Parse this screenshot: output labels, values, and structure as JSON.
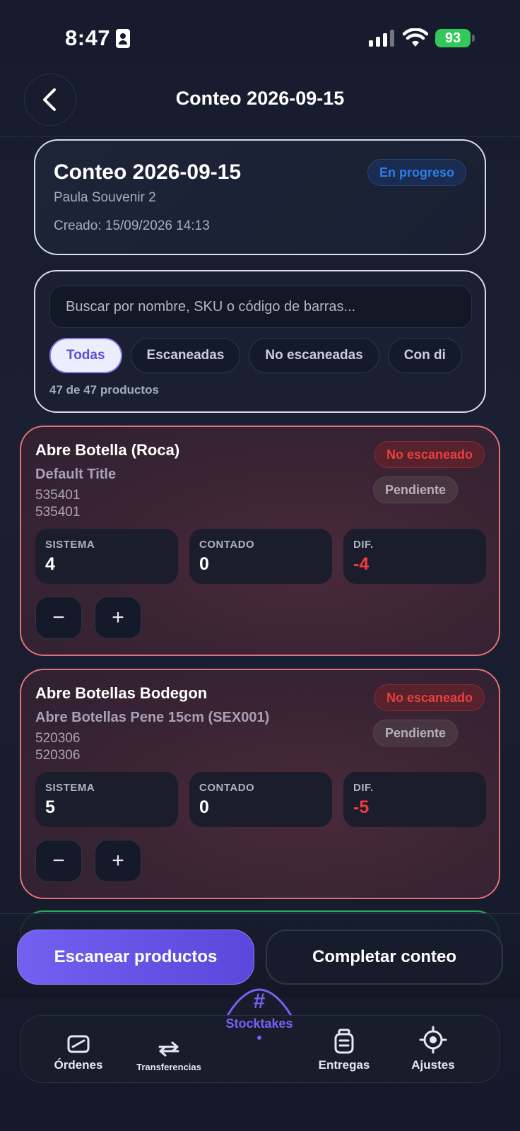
{
  "status_bar": {
    "time": "8:47",
    "battery": "93"
  },
  "header": {
    "title": "Conteo 2026-09-15"
  },
  "info_card": {
    "title": "Conteo 2026-09-15",
    "location": "Paula Souvenir 2",
    "created": "Creado: 15/09/2026 14:13",
    "status_badge": "En progreso"
  },
  "search": {
    "placeholder": "Buscar por nombre, SKU o código de barras...",
    "filters": [
      "Todas",
      "Escaneadas",
      "No escaneadas",
      "Con di"
    ],
    "count_text": "47 de 47 productos"
  },
  "products": [
    {
      "name": "Abre Botella (Roca)",
      "variant": "Default Title",
      "sku": "535401",
      "barcode": "535401",
      "scan_badge": "No escaneado",
      "state_badge": "Pendiente",
      "stats": [
        {
          "label": "SISTEMA",
          "value": "4"
        },
        {
          "label": "CONTADO",
          "value": "0"
        },
        {
          "label": "DIF.",
          "value": "-4"
        }
      ],
      "minus": "−",
      "plus": "+"
    },
    {
      "name": "Abre Botellas Bodegon",
      "variant": "Abre Botellas Pene 15cm (SEX001)",
      "sku": "520306",
      "barcode": "520306",
      "scan_badge": "No escaneado",
      "state_badge": "Pendiente",
      "stats": [
        {
          "label": "SISTEMA",
          "value": "5"
        },
        {
          "label": "CONTADO",
          "value": "0"
        },
        {
          "label": "DIF.",
          "value": "-5"
        }
      ],
      "minus": "−",
      "plus": "+"
    }
  ],
  "actions": {
    "scan_label": "Escanear productos",
    "complete_label": "Completar conteo"
  },
  "tabbar": {
    "items": [
      {
        "label": "Órdenes",
        "icon": "orders-icon"
      },
      {
        "label": "Transferencias",
        "icon": "transfer-icon"
      },
      {
        "label": "Stocktakes",
        "icon": "hash-icon",
        "glyph": "#"
      },
      {
        "label": "Entregas",
        "icon": "delivery-icon"
      },
      {
        "label": "Ajustes",
        "icon": "settings-icon"
      }
    ]
  },
  "colors": {
    "accent": "#7363f2",
    "danger": "#ef3b3b",
    "success": "#34c759",
    "progress_blue": "#2f7be8"
  }
}
